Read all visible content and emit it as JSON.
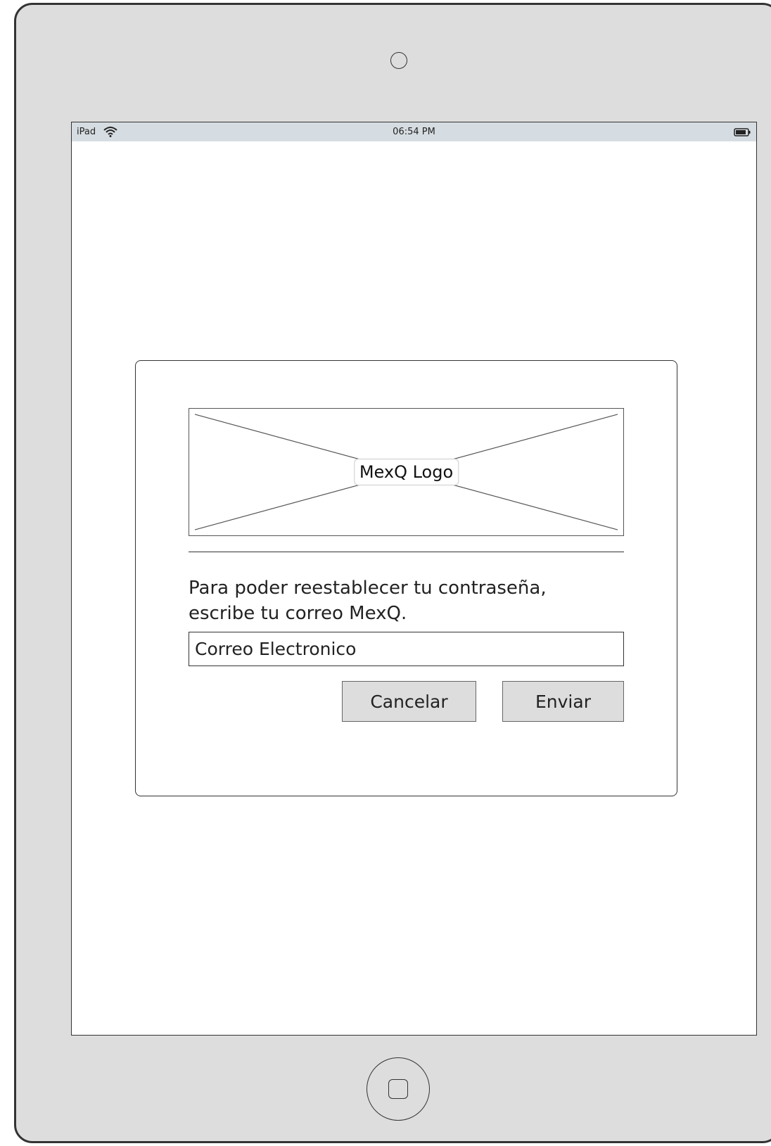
{
  "status_bar": {
    "device_label": "iPad",
    "time": "06:54 PM",
    "wifi_icon": "wifi-icon",
    "battery_icon": "battery-icon"
  },
  "dialog": {
    "logo_text": "MexQ Logo",
    "instructions_line1": "Para poder reestablecer tu contraseña,",
    "instructions_line2": "escribe tu correo MexQ.",
    "email_placeholder": "Correo Electronico",
    "cancel_label": "Cancelar",
    "send_label": "Enviar"
  },
  "device": {
    "camera_icon": "camera-icon",
    "home_icon": "home-button-icon"
  },
  "colors": {
    "bezel": "#dddddd",
    "status_bar": "#d6dde2",
    "button_bg": "#dddddd",
    "outline": "#333333"
  }
}
